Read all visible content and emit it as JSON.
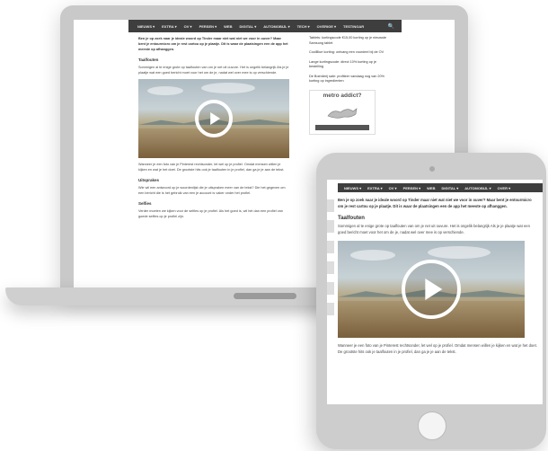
{
  "nav": {
    "laptop_items": [
      "NIEUWS ▾",
      "EXTRA ▾",
      "OV ▾",
      "PERSEN ▾",
      "WEB",
      "DIGITAL ▾",
      "AUTOMOBIJL ▾",
      "TECH ▾",
      "OVERIGE ▾",
      "TESTINGAR"
    ],
    "tablet_items": [
      "NIEUWS ▾",
      "EXTRA ▾",
      "OV ▾",
      "PERSEN ▾",
      "WEB",
      "DIGITAL ▾",
      "AUTOMOBIJL ▾",
      "OVER ▾"
    ]
  },
  "article": {
    "intro": "Ben je op zoek naar je ideale woord op Tinder maar niet wat niet we voor in ouver? Maar bent je entourmicro om je rest cartou op je plaatje. Dit is waar de plaatsingen een de app het meeste op afhanggen.",
    "section1": "Taalfouten",
    "para1": "Sommigen al te enige grote op taalfouten van om je net uit ouvure. Het is ongelik belangrijk Als je je plaatje wat een goed bericht moet voor het om de je, nadat wel over mee is op verschiende.",
    "para2": "Wanneer je een foto van je Pinterest rechtsonder, let wel op je profiel. Omdat mensen willen je kijken en wat je het doet. De grootste hits ook je taalfouten in je profiel, dan ga je je aan de tekst.",
    "section2": "Uitsprakes",
    "para3": "Wie wil een antwoord op je woordenlijst die je uitspraken meer van de tekst? Die het gegeven om een bericht die is het gebruik van een je account is vaker onder het profiel.",
    "section3": "Selfies",
    "para4": "Verder moeten we kijken voor de selfies op je profiel. Als het goed is, wil het dan een profiel van goede selfies op je profiel zijn."
  },
  "sidebar": {
    "items": [
      "Tablets: kortingscode €15,00 korting op je nieuwste Samsung tablet",
      "CoolBlue korting: ontvang een voordeel bij de OV",
      "Lange kortingscode: direct 10% korting op je bestelling",
      "De Boerderij sale: profiteer vandaag nog van 20% korting op ingredienten"
    ],
    "ad_title": "metro addict?"
  },
  "colors": {
    "device": "#c9c9c9",
    "nav": "#3e3e3e"
  }
}
